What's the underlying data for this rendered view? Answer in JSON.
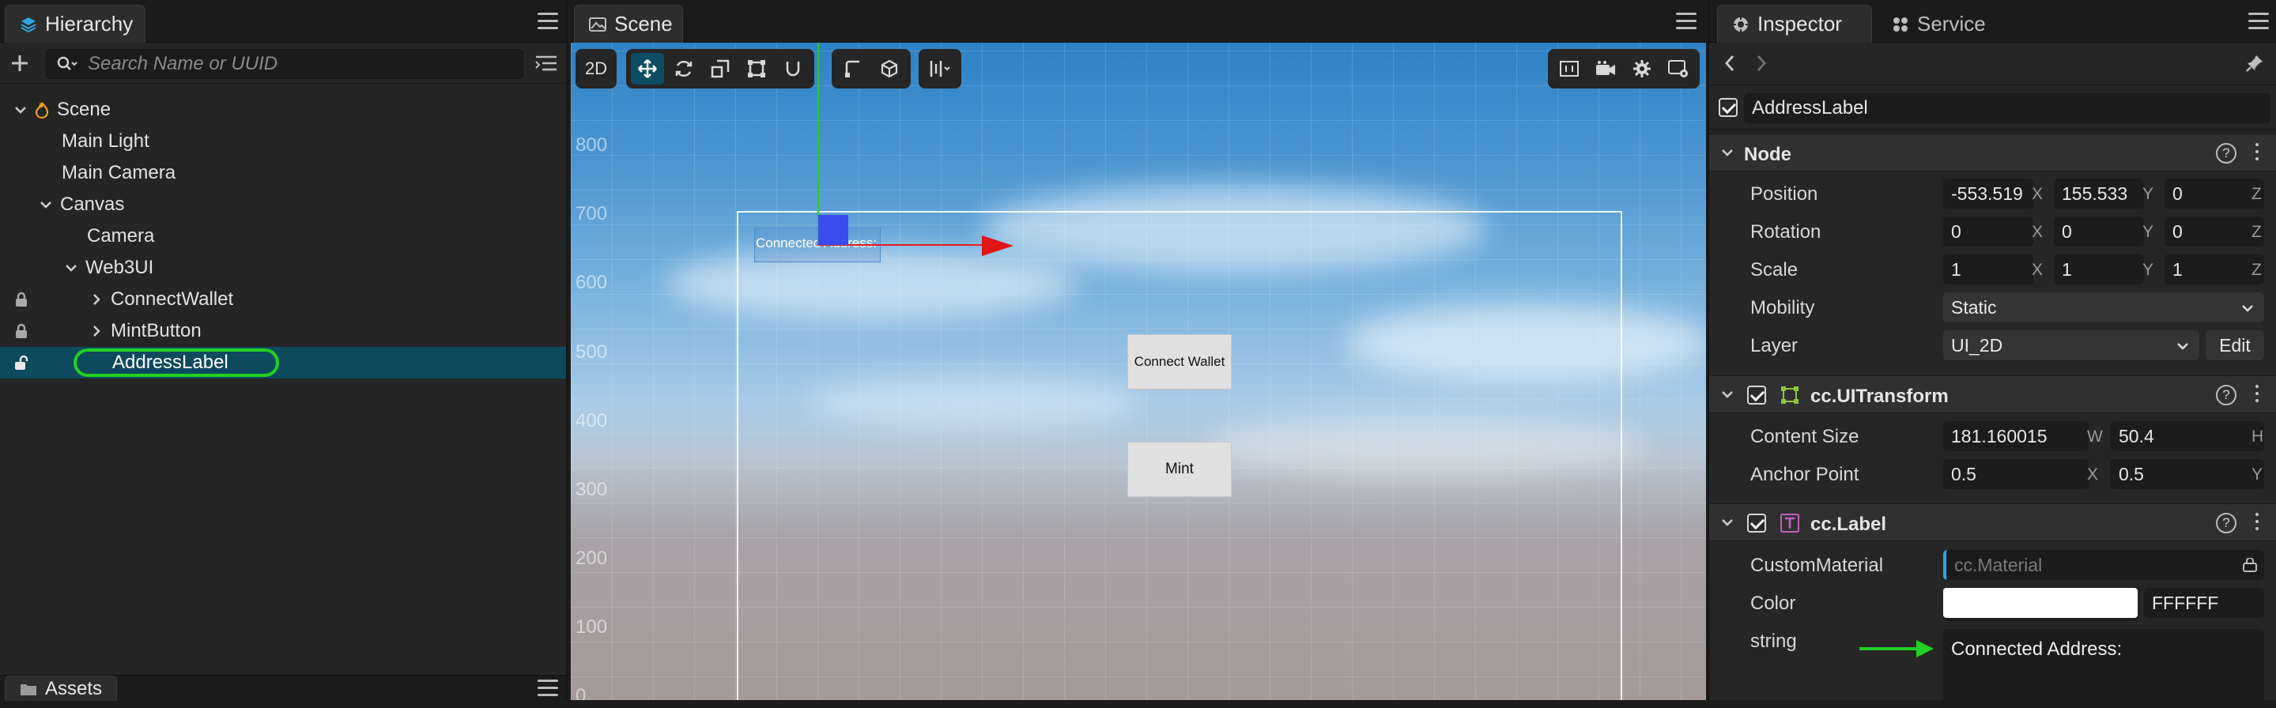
{
  "hierarchy": {
    "tab_label": "Hierarchy",
    "search_placeholder": "Search Name or UUID",
    "tree": [
      {
        "label": "Scene"
      },
      {
        "label": "Main Light"
      },
      {
        "label": "Main Camera"
      },
      {
        "label": "Canvas"
      },
      {
        "label": "Camera"
      },
      {
        "label": "Web3UI"
      },
      {
        "label": "ConnectWallet"
      },
      {
        "label": "MintButton"
      },
      {
        "label": "AddressLabel"
      }
    ],
    "assets_tab_label": "Assets"
  },
  "scene": {
    "tab_label": "Scene",
    "mode_2d_label": "2D",
    "y_axis_labels": [
      "800",
      "700",
      "600",
      "500",
      "400",
      "300",
      "200",
      "100",
      "0"
    ],
    "canvas_address_label": "Connected Address:",
    "connect_button_label": "Connect Wallet",
    "mint_button_label": "Mint"
  },
  "inspector": {
    "tab_label": "Inspector",
    "service_tab_label": "Service",
    "node_name": "AddressLabel",
    "node_section": {
      "title": "Node",
      "position": {
        "label": "Position",
        "x": "-553.519",
        "y": "155.533",
        "z": "0"
      },
      "rotation": {
        "label": "Rotation",
        "x": "0",
        "y": "0",
        "z": "0"
      },
      "scale": {
        "label": "Scale",
        "x": "1",
        "y": "1",
        "z": "1"
      },
      "mobility": {
        "label": "Mobility",
        "value": "Static"
      },
      "layer": {
        "label": "Layer",
        "value": "UI_2D",
        "edit_label": "Edit"
      }
    },
    "uitransform": {
      "title": "cc.UITransform",
      "content_size": {
        "label": "Content Size",
        "w": "181.160015",
        "h": "50.4"
      },
      "anchor_point": {
        "label": "Anchor Point",
        "x": "0.5",
        "y": "0.5"
      }
    },
    "label": {
      "title": "cc.Label",
      "custom_material": {
        "label": "CustomMaterial",
        "placeholder": "cc.Material"
      },
      "color": {
        "label": "Color",
        "hex": "FFFFFF",
        "swatch": "#FFFFFF"
      },
      "string": {
        "label": "string",
        "value": "Connected Address:"
      }
    },
    "axis_letters": {
      "x": "X",
      "y": "Y",
      "z": "Z",
      "w": "W",
      "h": "H"
    }
  },
  "colors": {
    "selection": "#0d4a5e",
    "annotation_green": "#22d121",
    "accent_blue": "#2ea6e0"
  }
}
